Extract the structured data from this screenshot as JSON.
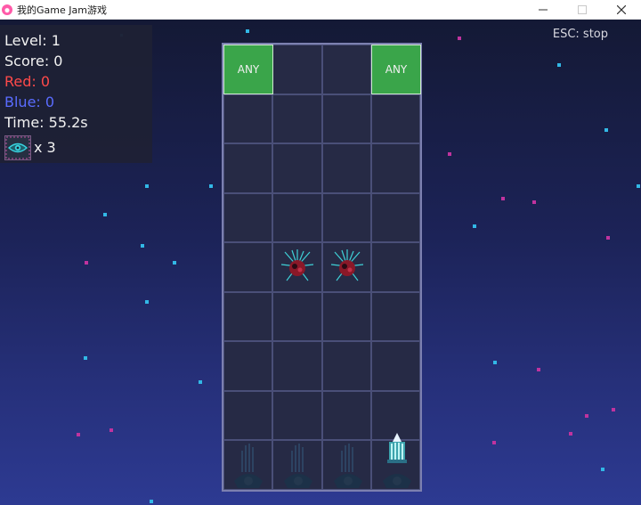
{
  "window": {
    "title": "我的Game Jam游戏",
    "controls": {
      "minimize": "—",
      "maximize": "☐",
      "close": "✕"
    }
  },
  "hud": {
    "level": "Level: 1",
    "score": "Score: 0",
    "red": "Red: 0",
    "blue": "Blue: 0",
    "time": "Time: 55.2s",
    "lives": "x 3"
  },
  "hint": "ESC: stop",
  "board": {
    "columns": 4,
    "rows": 9,
    "targets": [
      {
        "label": "ANY",
        "column": 1,
        "row": 1
      },
      {
        "label": "ANY",
        "column": 4,
        "row": 1
      }
    ],
    "enemies": [
      {
        "type": "red-spiky-blob",
        "column": 2,
        "row": 5
      },
      {
        "type": "red-spiky-blob",
        "column": 3,
        "row": 5
      }
    ],
    "launchers": [
      {
        "column": 1,
        "row": 9,
        "active": false
      },
      {
        "column": 2,
        "row": 9,
        "active": false
      },
      {
        "column": 3,
        "row": 9,
        "active": false
      },
      {
        "column": 4,
        "row": 9,
        "active": true
      }
    ]
  },
  "colors": {
    "target_green": "#3aa54a",
    "red_counter": "#ff4a4a",
    "blue_counter": "#5a6cff",
    "star_cyan": "#32b8e6",
    "star_magenta": "#c0339f"
  }
}
